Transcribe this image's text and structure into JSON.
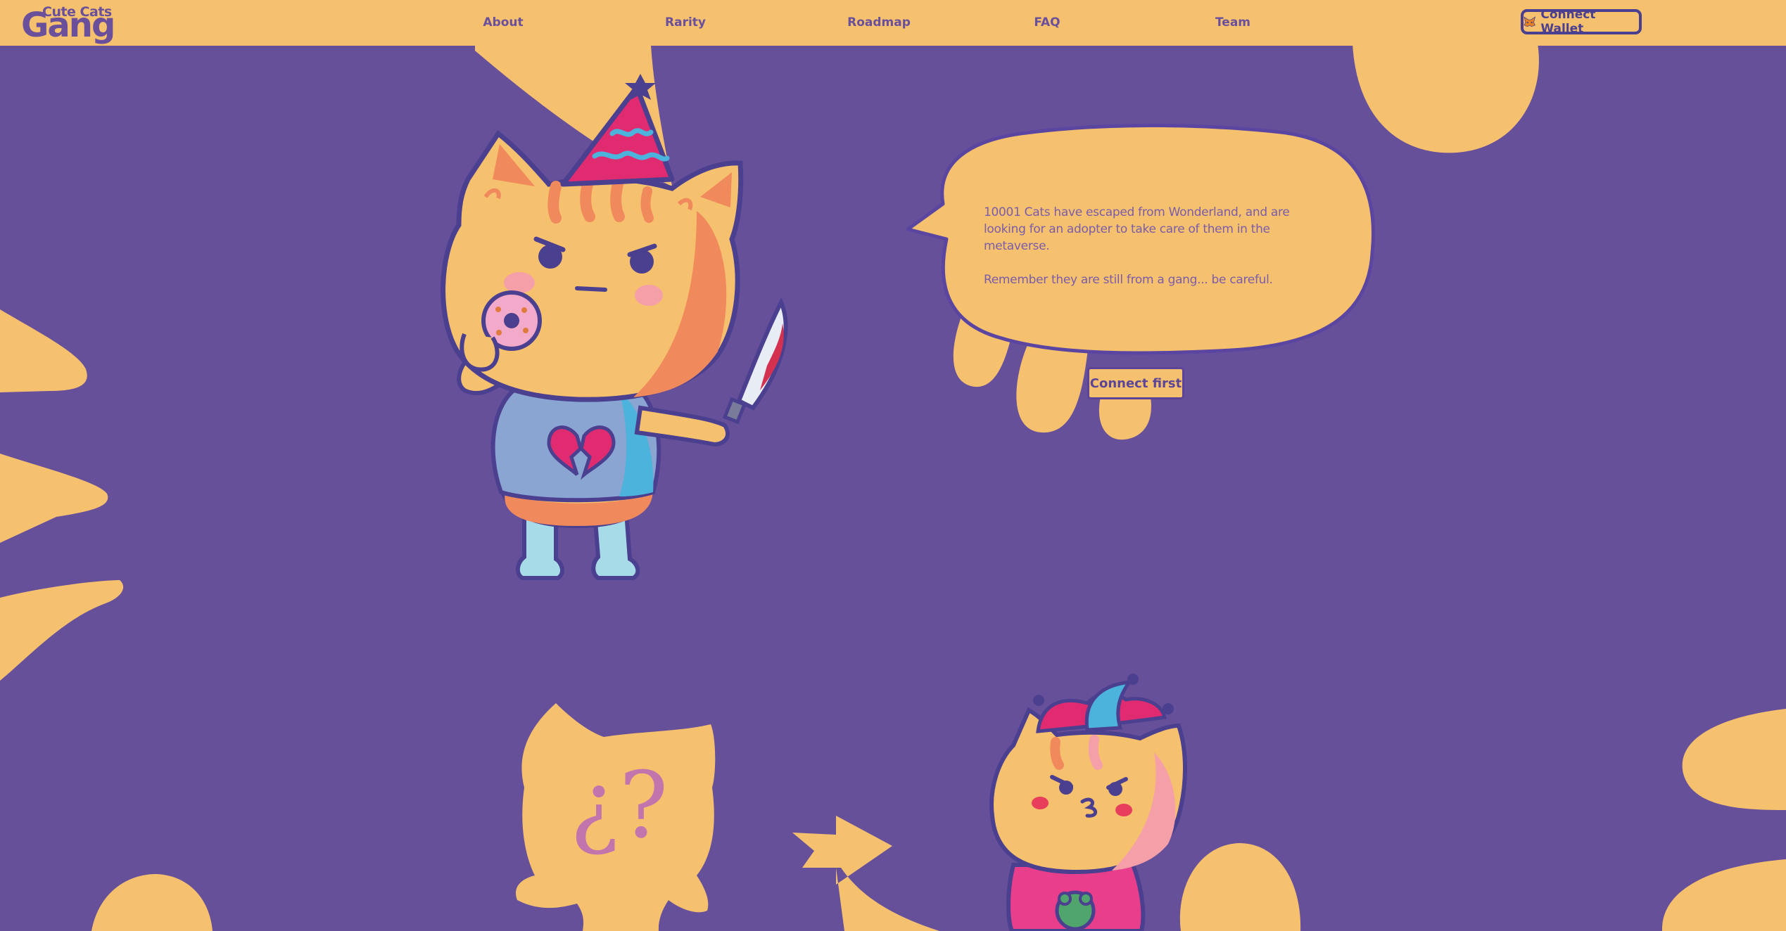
{
  "brand": {
    "logo_small": "Cute Cats",
    "logo_big": "Gang"
  },
  "nav": {
    "items": [
      {
        "label": "About"
      },
      {
        "label": "Rarity"
      },
      {
        "label": "Roadmap"
      },
      {
        "label": "FAQ"
      },
      {
        "label": "Team"
      }
    ],
    "wallet_button": "Connect Wallet",
    "wallet_icon": "metamask-fox-icon"
  },
  "hero": {
    "paragraphs": [
      "10001 Cats have escaped from Wonderland, and are looking for an adopter to take care of them in the metaverse.",
      "Remember they are still from a gang... be careful."
    ],
    "connect_button": "Connect first"
  },
  "mystery": {
    "glyph": "¿?"
  },
  "colors": {
    "background": "#67509a",
    "accent_yellow": "#f6c16f",
    "outline": "#4b3f8f"
  }
}
